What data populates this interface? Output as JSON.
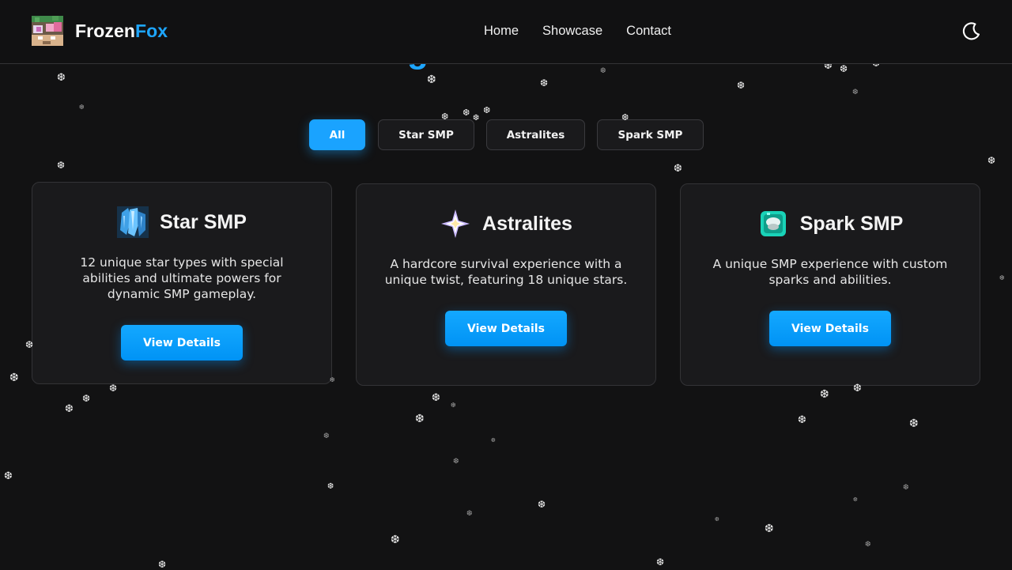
{
  "header": {
    "brand_part1": "Frozen",
    "brand_part2": "Fox",
    "nav": [
      "Home",
      "Showcase",
      "Contact"
    ]
  },
  "filters": [
    "All",
    "Star SMP",
    "Astralites",
    "Spark SMP"
  ],
  "active_filter": "All",
  "cards": [
    {
      "title": "Star SMP",
      "icon": "blue-crystal-icon",
      "description": "12 unique star types with special abilities and ultimate powers for dynamic SMP gameplay.",
      "button": "View Details"
    },
    {
      "title": "Astralites",
      "icon": "sparkle-star-icon",
      "description": "A hardcore survival experience with a unique twist, featuring 18 unique stars.",
      "button": "View Details"
    },
    {
      "title": "Spark SMP",
      "icon": "spark-orb-icon",
      "description": "A unique SMP experience with custom sparks and abilities.",
      "button": "View Details"
    }
  ],
  "colors": {
    "accent": "#1ea6ff",
    "background": "#121213",
    "card": "#1a1a1c"
  }
}
